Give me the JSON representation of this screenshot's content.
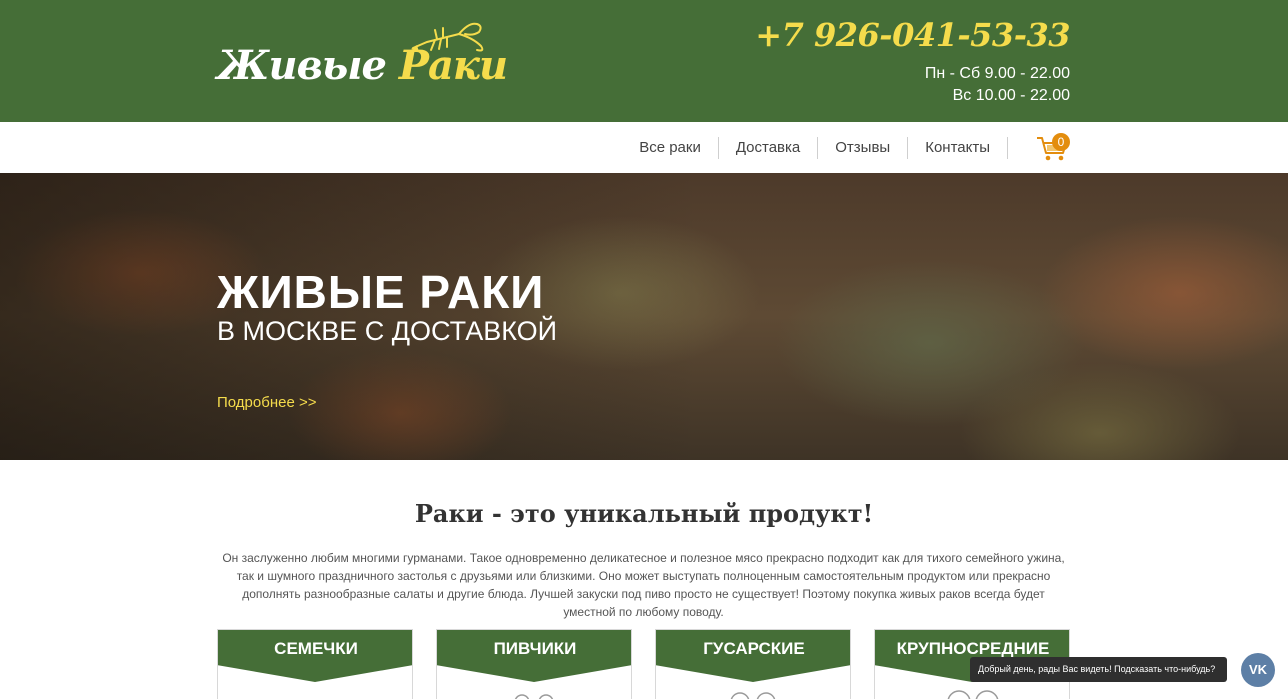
{
  "header": {
    "logo": {
      "word1": "Живые",
      "word2": "Раки",
      "icon": "crayfish-icon"
    },
    "phone": "+7 926-041-53-33",
    "hours": [
      "Пн - Сб 9.00 - 22.00",
      "Вс 10.00 - 22.00"
    ]
  },
  "nav": {
    "items": [
      "Все раки",
      "Доставка",
      "Отзывы",
      "Контакты"
    ],
    "cart": {
      "icon": "cart-icon",
      "count": "0"
    }
  },
  "hero": {
    "title": "ЖИВЫЕ РАКИ",
    "subtitle": "В МОСКВЕ С ДОСТАВКОЙ",
    "link": "Подробнее >>"
  },
  "intro": {
    "title": "Раки - это уникальный продукт!",
    "text": "Он заслуженно любим многими гурманами. Такое одновременно деликатесное и полезное мясо прекрасно подходит как для тихого семейного ужина, так и шумного праздничного застолья с друзьями или близкими. Оно может выступать полноценным самостоятельным продуктом или прекрасно дополнять разнообразные салаты и другие блюда. Лучшей закуски под пиво просто не существует! Поэтому покупка живых раков всегда будет уместной по любому поводу."
  },
  "cards": [
    {
      "title": "СЕМЕЧКИ"
    },
    {
      "title": "ПИВЧИКИ"
    },
    {
      "title": "ГУСАРСКИЕ"
    },
    {
      "title": "КРУПНОСРЕДНИЕ"
    }
  ],
  "chat": {
    "message": "Добрый день, рады Вас видеть! Подсказать что-нибудь?",
    "button_label": "VK",
    "icon": "vk-icon"
  },
  "colors": {
    "brand_green": "#456e37",
    "accent_yellow": "#f5dc4c",
    "badge_orange": "#e38d0d"
  }
}
